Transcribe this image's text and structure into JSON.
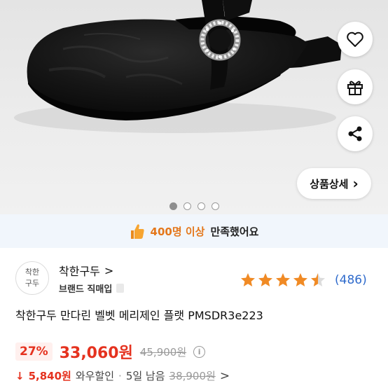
{
  "product_image": {
    "alt": "black velvet mary jane flat with rhinestone buckle",
    "colors": {
      "background": "#e8e8e8",
      "shoe": "#141414",
      "sparkle": "#cfcfcf"
    }
  },
  "actions": {
    "wishlist_icon": "heart-icon",
    "gift_icon": "gift-icon",
    "share_icon": "share-icon",
    "detail_label": "상품상세",
    "detail_chevron": "›"
  },
  "carousel": {
    "count": 4,
    "active_index": 0
  },
  "satisfaction": {
    "icon": "thumbs-up-icon",
    "highlight": "400명 이상",
    "rest": "만족했어요"
  },
  "seller": {
    "logo_line1": "착한",
    "logo_line2": "구두",
    "name": "착한구두",
    "chevron": ">",
    "subtitle": "브랜드 직매입"
  },
  "rating": {
    "stars": 4.5,
    "review_count": "(486)",
    "star_color": "#f08a24"
  },
  "product": {
    "title": "착한구두 만다린 벨벳 메리제인 플랫 PMSDR3e223"
  },
  "price": {
    "discount": "27%",
    "sale": "33,060원",
    "original": "45,900원",
    "info_icon": "info-icon",
    "accent": "#e5321f"
  },
  "wow": {
    "arrow": "↓",
    "amount": "5,840원",
    "label": "와우할인",
    "separator": "·",
    "remaining": "5일 남음",
    "original": "38,900원",
    "chevron": ">"
  }
}
